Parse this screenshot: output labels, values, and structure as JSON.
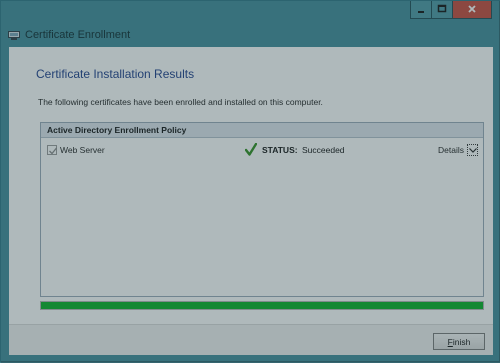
{
  "window": {
    "title": "Certificate Enrollment",
    "title_icon": "certificate-app-icon",
    "controls": [
      "minimize-icon",
      "maximize-icon",
      "close-icon"
    ]
  },
  "page": {
    "heading": "Certificate Installation Results",
    "intro": "The following certificates have been enrolled and installed on this computer."
  },
  "policy_group": {
    "title": "Active Directory Enrollment Policy",
    "items": [
      {
        "label": "Web Server",
        "checked": true,
        "status_icon": "green-check-icon",
        "status_label": "STATUS:",
        "status_value": "Succeeded",
        "details_label": "Details",
        "details_icon": "chevron-down-icon"
      }
    ]
  },
  "progress": {
    "value": 1.0,
    "color": "#06b025"
  },
  "footer": {
    "finish_label_underlined": "F",
    "finish_label_rest": "inish"
  },
  "colors": {
    "title_bar": "#3f8c99",
    "heading": "#1e3e8c",
    "close_button": "#c7493b",
    "check": "#2f8f1f"
  }
}
